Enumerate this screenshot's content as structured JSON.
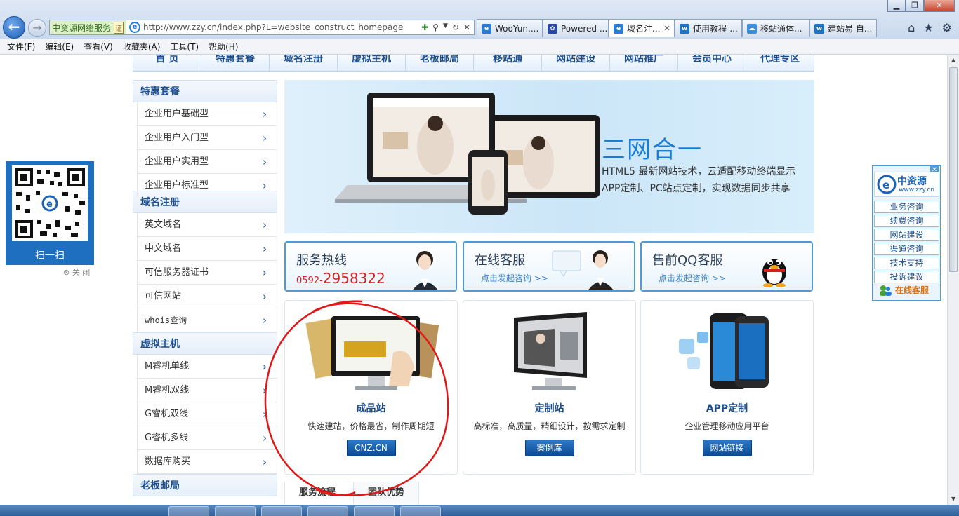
{
  "window": {
    "minimize": "▁",
    "maximize": "❐",
    "close": "✕"
  },
  "addressbar": {
    "cert_label": "中资源网络服务",
    "cert_icon": "证",
    "url": "http://www.zzy.cn/index.php?L=website_construct_homepage"
  },
  "tabs": [
    {
      "label": "WooYun....",
      "icon": "ie-icon",
      "active": false
    },
    {
      "label": "Powered ...",
      "icon": "paw-icon",
      "active": false
    },
    {
      "label": "域名注...",
      "icon": "ie-icon",
      "active": true,
      "close": "✕"
    },
    {
      "label": "使用教程-...",
      "icon": "w-icon",
      "active": false
    },
    {
      "label": "移站通体...",
      "icon": "cloud-icon",
      "active": false
    },
    {
      "label": "建站易 自...",
      "icon": "w-icon",
      "active": false
    }
  ],
  "menubar": [
    "文件(F)",
    "编辑(E)",
    "查看(V)",
    "收藏夹(A)",
    "工具(T)",
    "帮助(H)"
  ],
  "site_nav": [
    "首 页",
    "特惠套餐",
    "域名注册",
    "虚拟主机",
    "老板邮局",
    "移站通",
    "网站建设",
    "网站推广",
    "会员中心",
    "代理专区"
  ],
  "sidebar": {
    "sections": [
      {
        "title": "特惠套餐",
        "items": [
          "企业用户基础型",
          "企业用户入门型",
          "企业用户实用型",
          "企业用户标准型"
        ]
      },
      {
        "title": "域名注册",
        "items": [
          "英文域名",
          "中文域名",
          "可信服务器证书",
          "可信网站",
          "whois查询"
        ]
      },
      {
        "title": "虚拟主机",
        "items": [
          "M睿机单线",
          "M睿机双线",
          "G睿机双线",
          "G睿机多线",
          "数据库购买"
        ]
      },
      {
        "title": "老板邮局",
        "items": []
      }
    ],
    "chevron": "›"
  },
  "banner": {
    "title": "三网合一",
    "line1": "HTML5 最新网站技术，云适配移动终端显示",
    "line2": "APP定制、PC站点定制，实现数据同步共享"
  },
  "services": [
    {
      "title": "服务热线",
      "phone_prefix": "0592-",
      "phone_number": "2958322"
    },
    {
      "title": "在线客服",
      "link": "点击发起咨询 >>"
    },
    {
      "title": "售前QQ客服",
      "link": "点击发起咨询 >>"
    }
  ],
  "cards": [
    {
      "title": "成品站",
      "desc": "快速建站，价格最省，制作周期短",
      "button": "CNZ.CN"
    },
    {
      "title": "定制站",
      "desc": "高标准，高质量，精细设计，按需求定制",
      "button": "案例库"
    },
    {
      "title": "APP定制",
      "desc": "企业管理移动应用平台",
      "button": "网站链接"
    }
  ],
  "bottom_tabs": [
    "服务流程",
    "团队优势"
  ],
  "qr": {
    "label": "扫一扫",
    "close": "⊗ 关 闭"
  },
  "cs_panel": {
    "close": "✕",
    "logo_name": "中资源",
    "logo_url": "www.zzy.cn",
    "items": [
      "业务咨询",
      "续费咨询",
      "网站建设",
      "渠道咨询",
      "技术支持",
      "投诉建议"
    ],
    "online": "在线客服"
  },
  "colors": {
    "brand_blue": "#1d4f8f",
    "accent": "#1a7dd1",
    "annotation_red": "#e01818",
    "phone_red": "#d32020"
  }
}
